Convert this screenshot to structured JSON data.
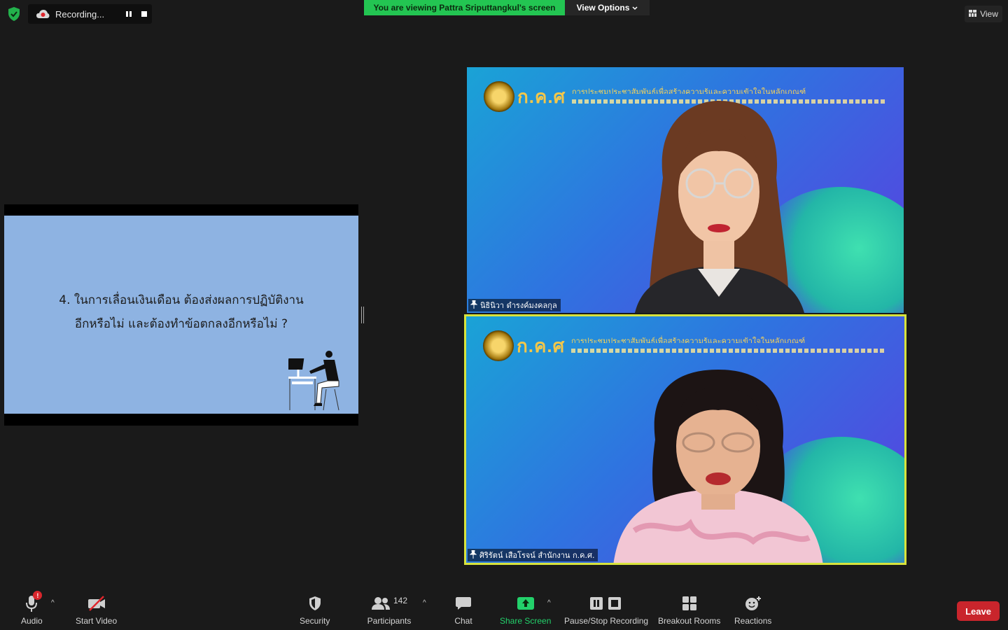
{
  "top": {
    "recording_label": "Recording...",
    "viewing_banner": "You are viewing Pattra Sriputtangkul's screen",
    "view_options_label": "View Options",
    "view_label": "View"
  },
  "shared_screen": {
    "slide_line1": "4. ในการเลื่อนเงินเดือน ต้องส่งผลการปฏิบัติงาน",
    "slide_line2": "อีกหรือไม่ และต้องทำข้อตกลงอีกหรือไม่ ?",
    "slide_bg": "#8eb3e2"
  },
  "videos": [
    {
      "name": "นิธินิวา ดำรงค์มงคลกุล",
      "logo": "ก.ค.ศ",
      "banner": "การประชุมประชาสัมพันธ์เพื่อสร้างความรู้และความเข้าใจในหลักเกณฑ์",
      "active_speaker": false
    },
    {
      "name": "ศิริรัตน์ เสือโรจน์ สำนักงาน ก.ค.ศ.",
      "logo": "ก.ค.ศ",
      "banner": "การประชุมประชาสัมพันธ์เพื่อสร้างความรู้และความเข้าใจในหลักเกณฑ์",
      "active_speaker": true,
      "highlight_color": "#d8e33c"
    }
  ],
  "toolbar": {
    "audio": "Audio",
    "audio_badge": "!",
    "start_video": "Start Video",
    "security": "Security",
    "participants": "Participants",
    "participant_count": "142",
    "chat": "Chat",
    "share_screen": "Share Screen",
    "pause_stop_recording": "Pause/Stop Recording",
    "breakout_rooms": "Breakout Rooms",
    "reactions": "Reactions",
    "leave": "Leave"
  },
  "colors": {
    "background": "#1a1a1a",
    "banner_green": "#23c552",
    "share_green": "#23d16b",
    "leave_red": "#c9252c"
  }
}
